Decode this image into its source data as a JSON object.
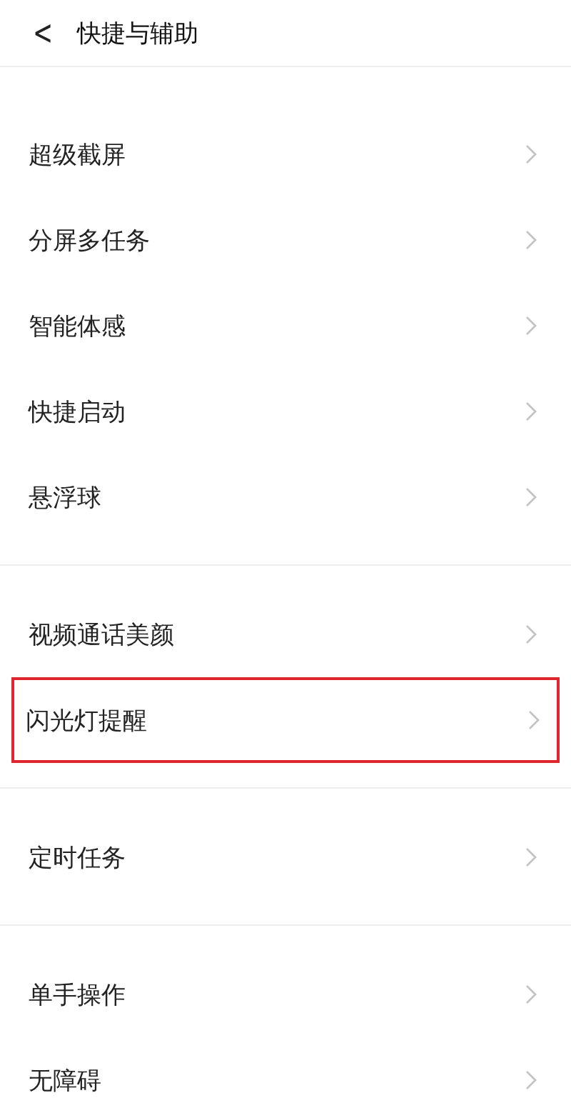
{
  "header": {
    "back": "<",
    "title": "快捷与辅助"
  },
  "groups": [
    {
      "items": [
        {
          "label": "超级截屏",
          "highlighted": false
        },
        {
          "label": "分屏多任务",
          "highlighted": false
        },
        {
          "label": "智能体感",
          "highlighted": false
        },
        {
          "label": "快捷启动",
          "highlighted": false
        },
        {
          "label": "悬浮球",
          "highlighted": false
        }
      ]
    },
    {
      "items": [
        {
          "label": "视频通话美颜",
          "highlighted": false
        },
        {
          "label": "闪光灯提醒",
          "highlighted": true
        }
      ]
    },
    {
      "items": [
        {
          "label": "定时任务",
          "highlighted": false
        }
      ]
    },
    {
      "items": [
        {
          "label": "单手操作",
          "highlighted": false
        },
        {
          "label": "无障碍",
          "highlighted": false
        }
      ]
    }
  ]
}
